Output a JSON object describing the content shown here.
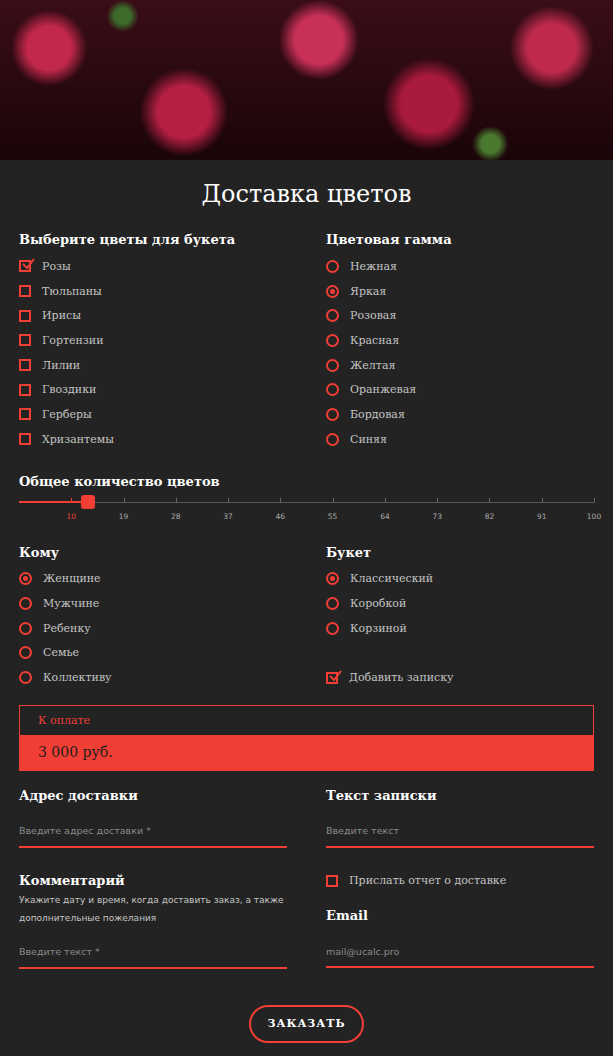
{
  "title": "Доставка цветов",
  "flowers": {
    "label": "Выберите цветы для букета",
    "items": [
      {
        "label": "Розы",
        "checked": true
      },
      {
        "label": "Тюльпаны",
        "checked": false
      },
      {
        "label": "Ирисы",
        "checked": false
      },
      {
        "label": "Гортензии",
        "checked": false
      },
      {
        "label": "Лилии",
        "checked": false
      },
      {
        "label": "Гвоздики",
        "checked": false
      },
      {
        "label": "Герберы",
        "checked": false
      },
      {
        "label": "Хризантемы",
        "checked": false
      }
    ]
  },
  "palette": {
    "label": "Цветовая гамма",
    "items": [
      {
        "label": "Нежная",
        "selected": false
      },
      {
        "label": "Яркая",
        "selected": true
      },
      {
        "label": "Розовая",
        "selected": false
      },
      {
        "label": "Красная",
        "selected": false
      },
      {
        "label": "Желтая",
        "selected": false
      },
      {
        "label": "Оранжевая",
        "selected": false
      },
      {
        "label": "Бордовая",
        "selected": false
      },
      {
        "label": "Синяя",
        "selected": false
      }
    ]
  },
  "quantity": {
    "label": "Общее количество цветов",
    "level": 0.12,
    "ticks": [
      "10",
      "19",
      "28",
      "37",
      "46",
      "55",
      "64",
      "73",
      "82",
      "91",
      "100"
    ]
  },
  "recipient": {
    "label": "Кому",
    "items": [
      {
        "label": "Женщине",
        "selected": true
      },
      {
        "label": "Мужчине",
        "selected": false
      },
      {
        "label": "Ребенку",
        "selected": false
      },
      {
        "label": "Семье",
        "selected": false
      },
      {
        "label": "Коллективу",
        "selected": false
      }
    ]
  },
  "bouquet": {
    "label": "Букет",
    "items": [
      {
        "label": "Классический",
        "selected": true
      },
      {
        "label": "Коробкой",
        "selected": false
      },
      {
        "label": "Корзиной",
        "selected": false
      }
    ]
  },
  "note": {
    "label": "Добавить записку",
    "checked": true
  },
  "price": {
    "label": "К оплате",
    "value": "3 000 руб."
  },
  "address": {
    "label": "Адрес доставки",
    "placeholder": "Введите адрес доставки *"
  },
  "noteText": {
    "label": "Текст записки",
    "placeholder": "Введите текст"
  },
  "comment": {
    "label": "Комментарий",
    "hint": "Укажите дату и время, когда доставить заказ, а также дополнительные пожелания",
    "placeholder": "Введите текст *"
  },
  "report": {
    "label": "Прислать отчет о доставке",
    "checked": false
  },
  "email": {
    "label": "Email",
    "placeholder": "mail@ucalc.pro"
  },
  "submit": "ЗАКАЗАТЬ"
}
